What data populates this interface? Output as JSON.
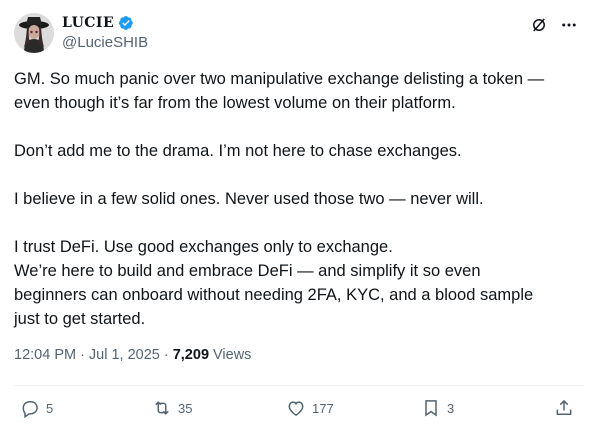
{
  "author": {
    "display_name": "LUCIE",
    "handle": "@LucieSHIB",
    "verified": true
  },
  "tweet": {
    "paragraphs": [
      "GM. So much panic over two manipulative exchange delisting a token —\neven though it’s far from the lowest volume on their platform.",
      "Don’t add me to the drama. I’m not here to chase exchanges.",
      "I believe in a few solid ones. Never used those two — never will.",
      "I trust DeFi. Use good exchanges only to exchange.\nWe’re here to build and embrace DeFi — and simplify it so even\nbeginners can onboard without needing 2FA, KYC, and a blood sample\njust to get started."
    ],
    "time": "12:04 PM",
    "separator": "·",
    "date": "Jul 1, 2025",
    "views_count": "7,209",
    "views_label": "Views"
  },
  "actions": {
    "replies": "5",
    "reposts": "35",
    "likes": "177",
    "bookmarks": "3"
  },
  "colors": {
    "verified": "#1d9bf0",
    "secondary_text": "#536471",
    "primary_text": "#0f1419"
  },
  "icons": [
    "verified-badge-icon",
    "grok-icon",
    "more-icon",
    "reply-icon",
    "repost-icon",
    "like-icon",
    "bookmark-icon",
    "share-icon"
  ]
}
